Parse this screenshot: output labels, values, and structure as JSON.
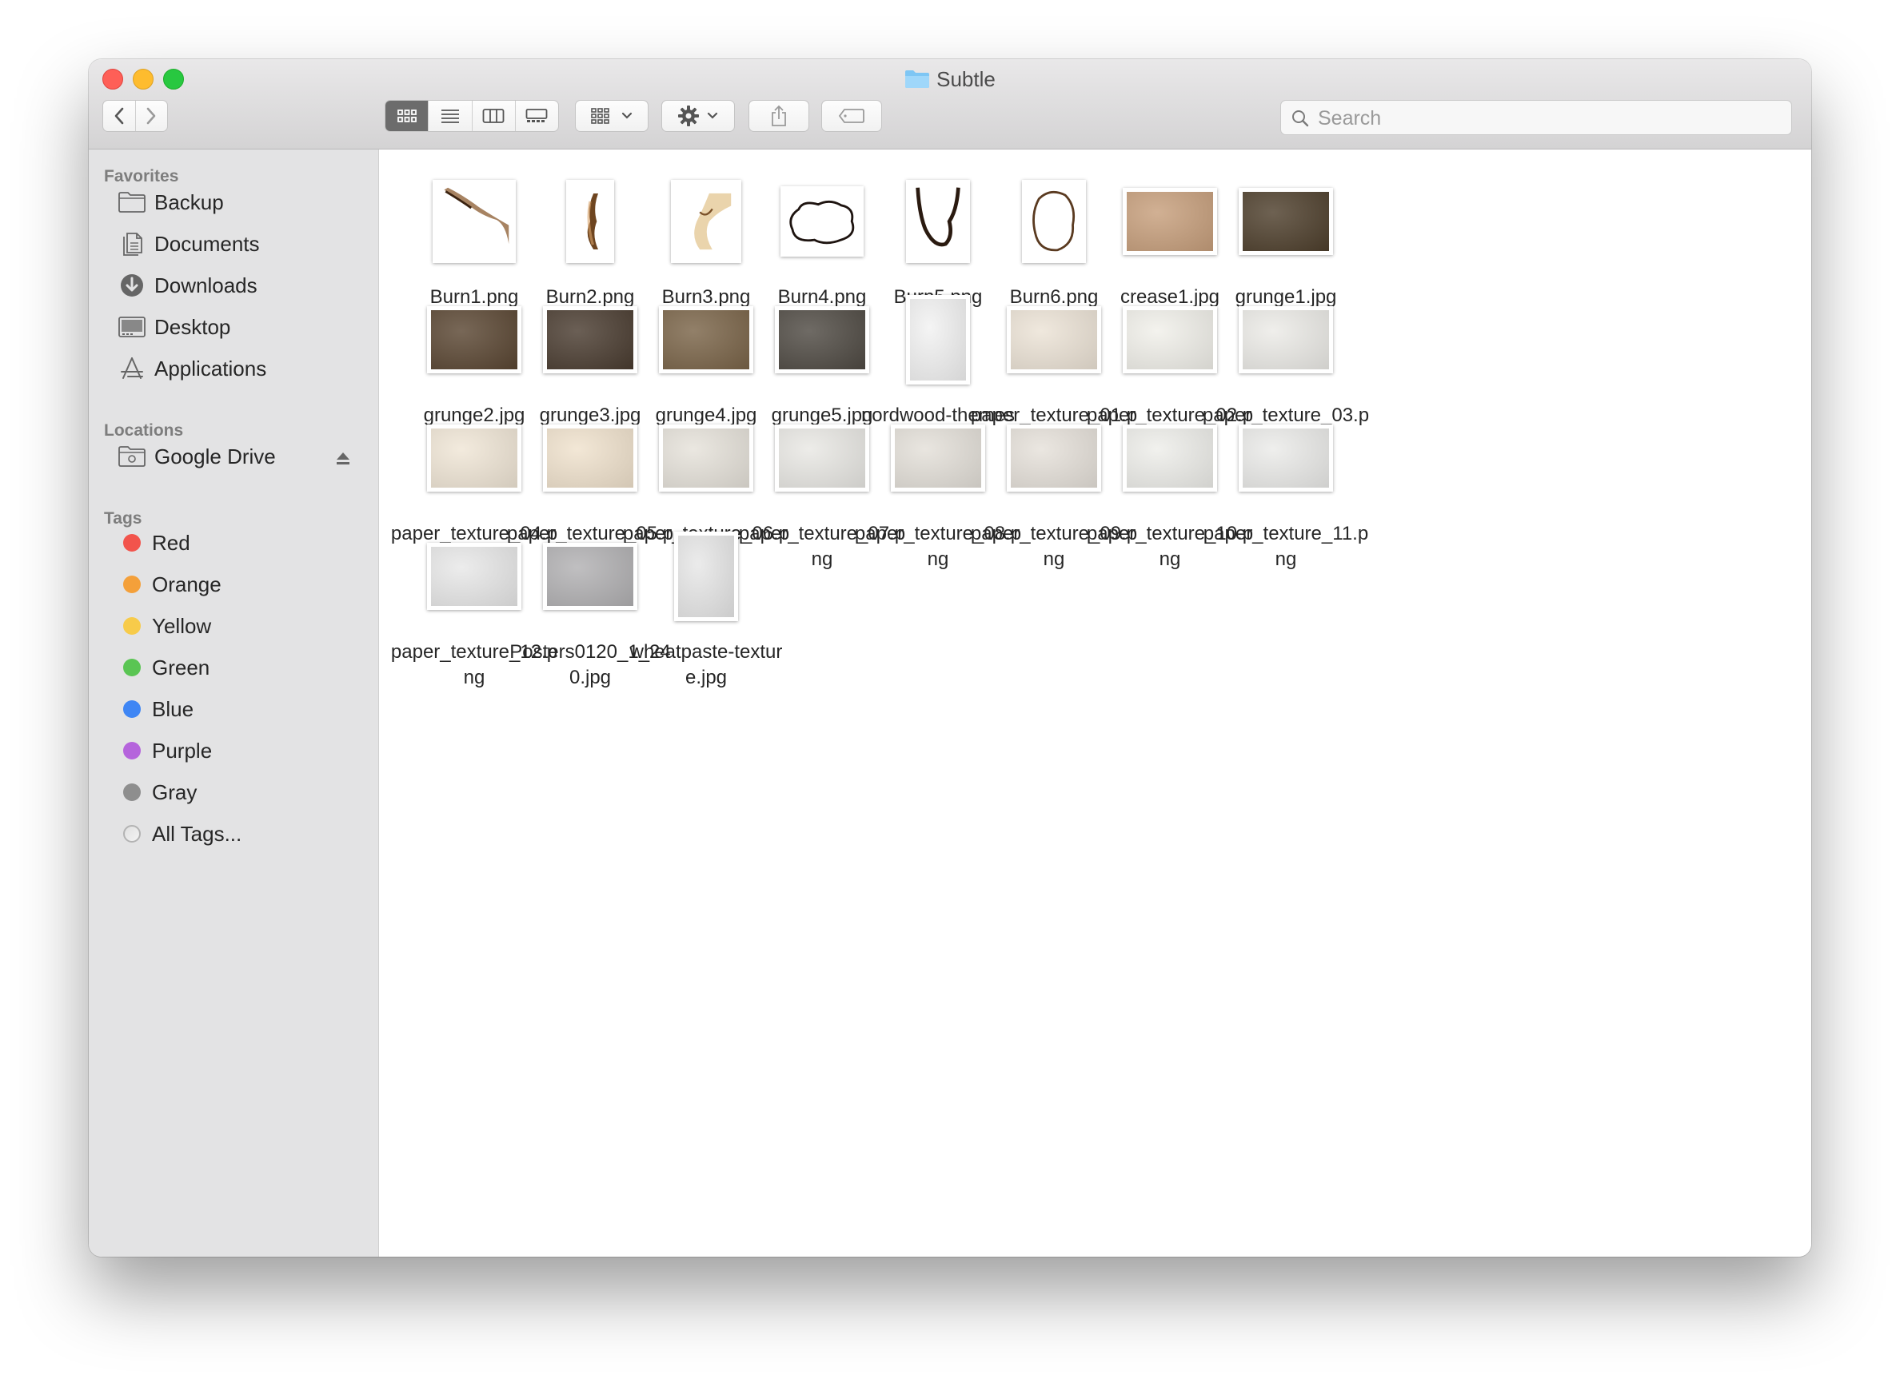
{
  "window": {
    "title": "Subtle",
    "title_icon": "folder-icon"
  },
  "toolbar": {
    "back_icon": "chevron-left-icon",
    "forward_icon": "chevron-right-icon",
    "view_modes": [
      "icon-view-icon",
      "list-view-icon",
      "column-view-icon",
      "gallery-view-icon"
    ],
    "active_view": "icon-view-icon",
    "group_icon": "group-by-icon",
    "action_icon": "gear-icon",
    "share_icon": "share-icon",
    "tag_icon": "tag-icon",
    "search_placeholder": "Search"
  },
  "sidebar": {
    "favorites_label": "Favorites",
    "favorites": [
      {
        "label": "Backup",
        "icon": "folder-icon"
      },
      {
        "label": "Documents",
        "icon": "documents-icon"
      },
      {
        "label": "Downloads",
        "icon": "download-icon"
      },
      {
        "label": "Desktop",
        "icon": "desktop-icon"
      },
      {
        "label": "Applications",
        "icon": "applications-icon"
      }
    ],
    "locations_label": "Locations",
    "locations": [
      {
        "label": "Google Drive",
        "icon": "drive-folder-icon",
        "eject_icon": "eject-icon"
      }
    ],
    "tags_label": "Tags",
    "tags": [
      {
        "label": "Red",
        "color": "#f2544c"
      },
      {
        "label": "Orange",
        "color": "#f4a03a"
      },
      {
        "label": "Yellow",
        "color": "#f7cb4a"
      },
      {
        "label": "Green",
        "color": "#5ac553"
      },
      {
        "label": "Blue",
        "color": "#3f86f4"
      },
      {
        "label": "Purple",
        "color": "#b564dc"
      },
      {
        "label": "Gray",
        "color": "#8e8e8e"
      },
      {
        "label": "All Tags...",
        "color": "all"
      }
    ]
  },
  "files": [
    {
      "name": "Burn1.png",
      "thumb": "burn"
    },
    {
      "name": "Burn2.png",
      "thumb": "burn"
    },
    {
      "name": "Burn3.png",
      "thumb": "burn"
    },
    {
      "name": "Burn4.png",
      "thumb": "burn"
    },
    {
      "name": "Burn5.png",
      "thumb": "burn"
    },
    {
      "name": "Burn6.png",
      "thumb": "burn"
    },
    {
      "name": "crease1.jpg",
      "thumb": "#c79f7c"
    },
    {
      "name": "grunge1.jpg",
      "thumb": "#4e3f2c"
    },
    {
      "name": "grunge2.jpg",
      "thumb": "#5a4632"
    },
    {
      "name": "grunge3.jpg",
      "thumb": "#4a3c30"
    },
    {
      "name": "grunge4.jpg",
      "thumb": "#7a6448"
    },
    {
      "name": "grunge5.jpg",
      "thumb": "#4f4a43"
    },
    {
      "name": "nordwood-themes-...lash.jpg",
      "thumb": "#f2f2f2"
    },
    {
      "name": "paper_texture_01.png",
      "thumb": "#ece3d6"
    },
    {
      "name": "paper_texture_02.png",
      "thumb": "#f1f0ea"
    },
    {
      "name": "paper_texture_03.png",
      "thumb": "#ecebe7"
    },
    {
      "name": "paper_texture_04.png",
      "thumb": "#f0e6d6"
    },
    {
      "name": "paper_texture_05.png",
      "thumb": "#f0e2cd"
    },
    {
      "name": "paper_texture_06.png",
      "thumb": "#e6e2da"
    },
    {
      "name": "paper_texture_07.png",
      "thumb": "#e9e8e4"
    },
    {
      "name": "paper_texture_08.png",
      "thumb": "#e4e0d9"
    },
    {
      "name": "paper_texture_09.png",
      "thumb": "#e6e1da"
    },
    {
      "name": "paper_texture_10.png",
      "thumb": "#eeeeea"
    },
    {
      "name": "paper_texture_11.png",
      "thumb": "#ebebe9"
    },
    {
      "name": "paper_texture_12.png",
      "thumb": "#e8e8e8"
    },
    {
      "name": "Posters0120_1_240.jpg",
      "thumb": "#b2b1b3"
    },
    {
      "name": "wheatpaste-texture.jpg",
      "thumb": "#e7e7e7"
    }
  ]
}
